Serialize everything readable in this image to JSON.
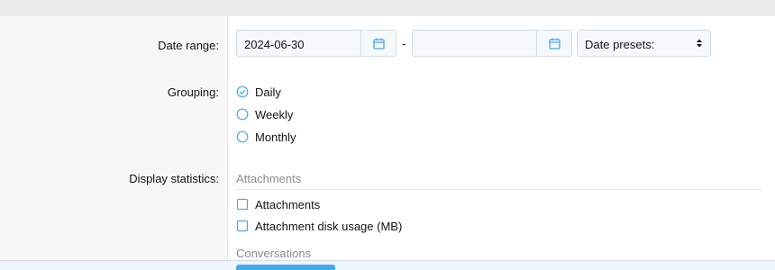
{
  "form": {
    "date_range": {
      "label": "Date range:",
      "start_value": "2024-06-30",
      "end_value": "",
      "separator": "-",
      "start_icon": "calendar-icon",
      "end_icon": "calendar-icon",
      "presets": {
        "selected": "Date presets:",
        "icon": "select-arrows-icon"
      }
    },
    "grouping": {
      "label": "Grouping:",
      "options": [
        {
          "label": "Daily",
          "checked": true
        },
        {
          "label": "Weekly",
          "checked": false
        },
        {
          "label": "Monthly",
          "checked": false
        }
      ]
    },
    "display_statistics": {
      "label": "Display statistics:",
      "sections": [
        {
          "heading": "Attachments",
          "options": [
            {
              "label": "Attachments",
              "checked": false
            },
            {
              "label": "Attachment disk usage (MB)",
              "checked": false
            }
          ]
        },
        {
          "heading": "Conversations",
          "options": []
        }
      ]
    }
  },
  "colors": {
    "accent": "#47a7eb",
    "input_bg": "#f5f9fc",
    "input_border": "#d3dde7",
    "label_col_bg": "#f7f7f7",
    "muted_text": "#8c8c8c"
  }
}
